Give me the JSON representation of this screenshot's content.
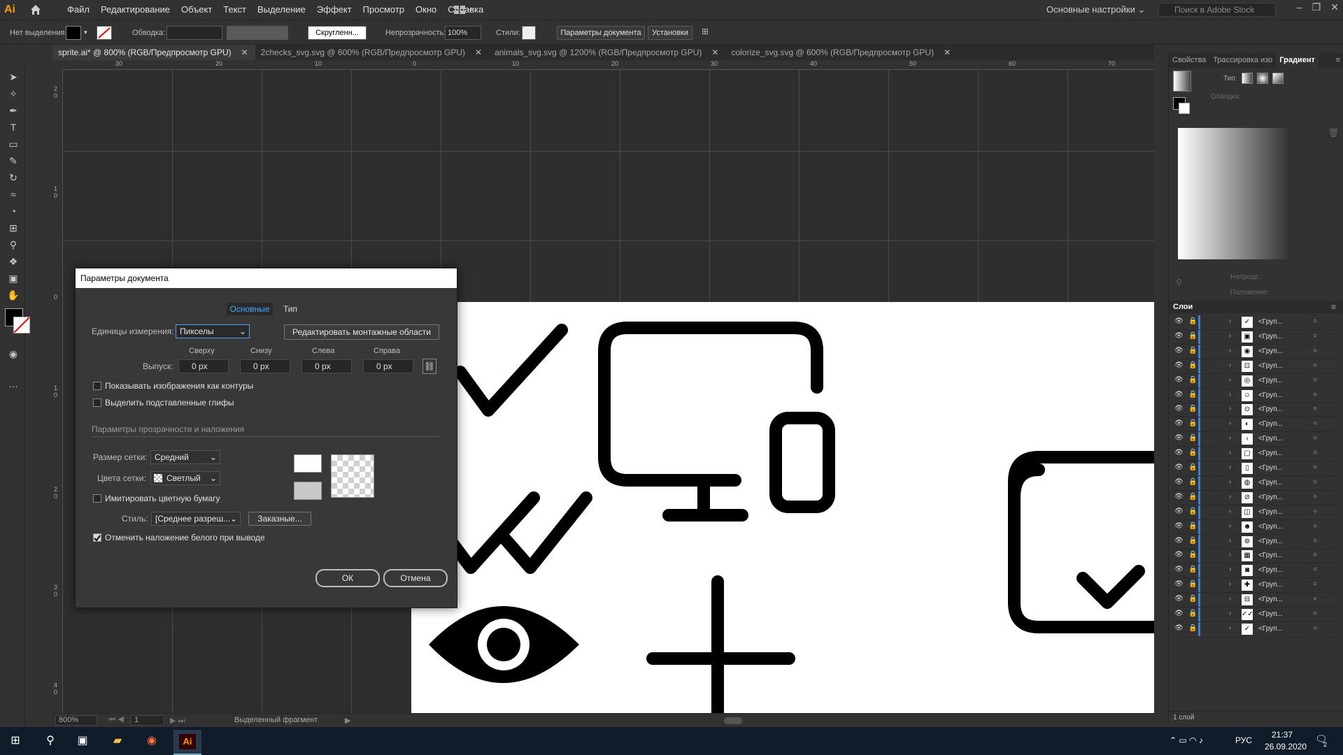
{
  "app": {
    "logo": "Ai"
  },
  "menu": [
    "Файл",
    "Редактирование",
    "Объект",
    "Текст",
    "Выделение",
    "Эффект",
    "Просмотр",
    "Окно",
    "Справка"
  ],
  "workspace": "Основные настройки",
  "search_placeholder": "Поиск в Adobe Stock",
  "control": {
    "no_selection": "Нет выделения",
    "stroke": "Обводка:",
    "brush": "Скругленн...",
    "opacity_label": "Непрозрачность:",
    "opacity": "100%",
    "styles": "Стили:",
    "doc_params": "Параметры документа",
    "settings": "Установки"
  },
  "tabs": [
    "sprite.ai* @ 800% (RGB/Предпросмотр GPU)",
    "2checks_svg.svg @ 600% (RGB/Предпросмотр GPU)",
    "animals_svg.svg @ 1200% (RGB/Предпросмотр GPU)",
    "colorize_svg.svg @ 600% (RGB/Предпросмотр GPU)"
  ],
  "ruler_h": [
    "30",
    "20",
    "10",
    "0",
    "10",
    "20",
    "30",
    "40",
    "50",
    "60",
    "70"
  ],
  "ruler_v": [
    "2 0",
    "1 0",
    "0",
    "1 0",
    "2 0",
    "3 0",
    "4 0"
  ],
  "status": {
    "zoom": "800%",
    "page": "1",
    "info": "Выделенный фрагмент"
  },
  "right_tabs": [
    "Свойства",
    "Трассировка изо",
    "Градиент"
  ],
  "gradient": {
    "type": "Тип:",
    "stroke": "Обводка:",
    "opacity": "Непрозр.:",
    "position": "Положение:"
  },
  "layers": {
    "title": "Слои",
    "row_label": "<Груп...",
    "footer": "1 слой"
  },
  "dialog": {
    "title": "Параметры документа",
    "tabs": [
      "Основные",
      "Тип"
    ],
    "units_label": "Единицы измерения:",
    "units": "Пикселы",
    "edit_artboards": "Редактировать монтажные области",
    "bleed_label": "Выпуск:",
    "bleed_cols": [
      "Сверху",
      "Снизу",
      "Слева",
      "Справа"
    ],
    "bleed_values": [
      "0 px",
      "0 px",
      "0 px",
      "0 px"
    ],
    "check_outline": "Показывать изображения как контуры",
    "check_glyphs": "Выделить подставленные глифы",
    "section": "Параметры прозрачности и наложения",
    "grid_size_label": "Размер сетки:",
    "grid_size": "Средний",
    "grid_color_label": "Цвета сетки:",
    "grid_color": "Светлый",
    "check_paper": "Имитировать цветную бумагу",
    "style_label": "Стиль:",
    "style": "[Среднее разреш...",
    "custom": "Заказные...",
    "check_white": "Отменить наложение белого при выводе",
    "ok": "ОК",
    "cancel": "Отмена"
  },
  "taskbar": {
    "lang": "РУС",
    "time": "21:37",
    "date": "26.09.2020",
    "notif": "2"
  }
}
